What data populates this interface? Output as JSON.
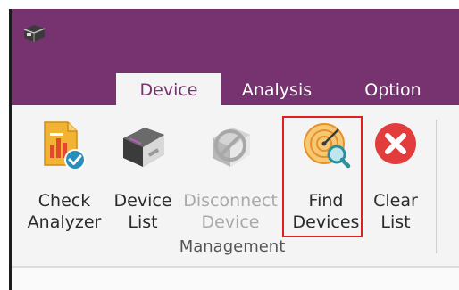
{
  "tabs": [
    {
      "label": "Device",
      "active": true
    },
    {
      "label": "Analysis",
      "active": false
    },
    {
      "label": "Option",
      "active": false
    }
  ],
  "ribbon": {
    "buttons": [
      {
        "line1": "Check",
        "line2": "Analyzer",
        "icon": "check-analyzer-icon",
        "enabled": true
      },
      {
        "line1": "Device",
        "line2": "List",
        "icon": "device-list-icon",
        "enabled": true
      },
      {
        "line1": "Disconnect",
        "line2": "Device",
        "icon": "disconnect-device-icon",
        "enabled": false
      },
      {
        "line1": "Find",
        "line2": "Devices",
        "icon": "radar-search-icon",
        "enabled": true
      },
      {
        "line1": "Clear",
        "line2": "List",
        "icon": "clear-icon",
        "enabled": true
      }
    ],
    "group_label": "Management"
  },
  "colors": {
    "title_bar": "#77336f",
    "ribbon_bg": "#f4f4f4",
    "highlight": "#e02020",
    "clear_red": "#e23c3c"
  }
}
